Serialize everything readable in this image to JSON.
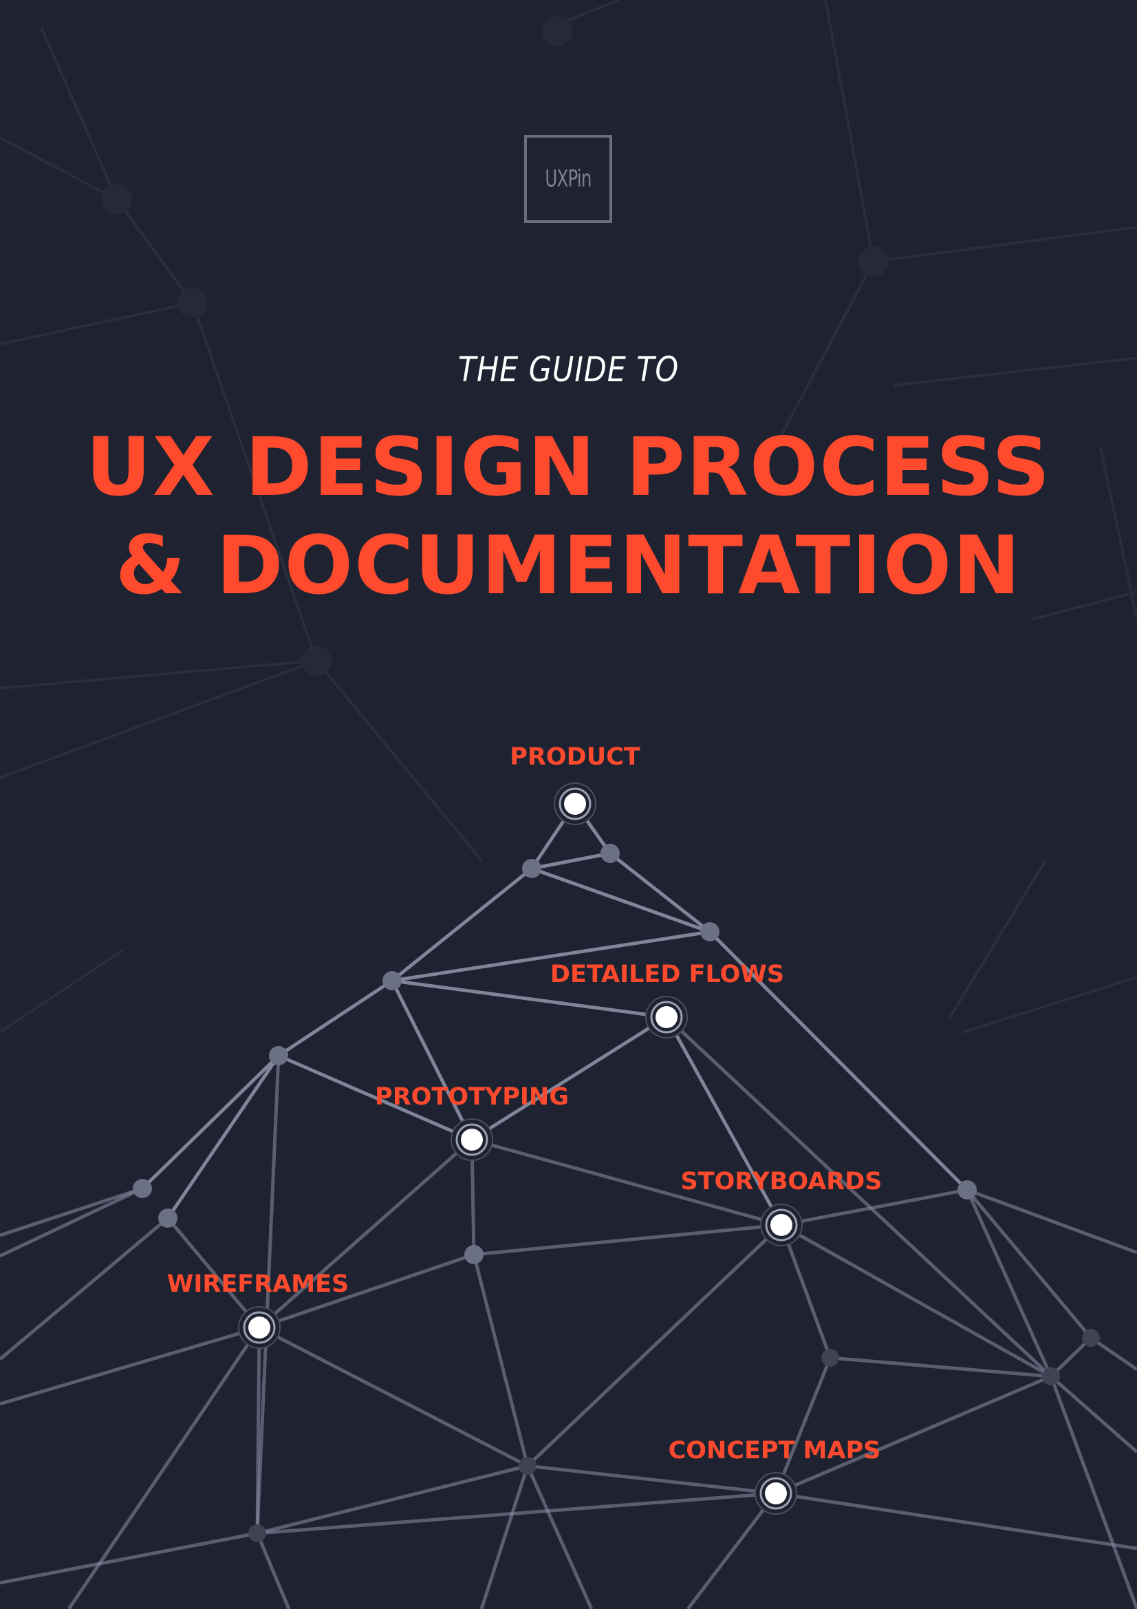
{
  "logo": {
    "text": "UXPin"
  },
  "cover": {
    "subtitle": "THE GUIDE TO",
    "title_line1": "UX DESIGN PROCESS",
    "title_line2": "& DOCUMENTATION"
  },
  "network": {
    "labels": [
      "PRODUCT",
      "DETAILED FLOWS",
      "PROTOTYPING",
      "STORYBOARDS",
      "WIREFRAMES",
      "CONCEPT MAPS"
    ]
  },
  "colors": {
    "background": "#1f2230",
    "accent": "#ff4a2e",
    "line": "#8b90a6",
    "node": "#6b7084"
  }
}
